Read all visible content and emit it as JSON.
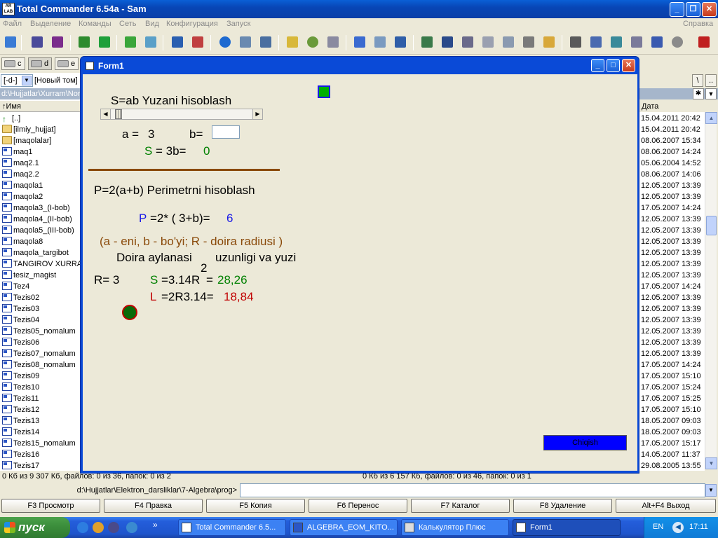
{
  "app": {
    "title": "Total Commander 6.54a - Sam",
    "menu": [
      "Файл",
      "Выделение",
      "Команды",
      "Сеть",
      "Вид",
      "Конфигурация",
      "Запуск"
    ],
    "help": "Справка"
  },
  "drives": [
    "c",
    "d",
    "e"
  ],
  "left_panel": {
    "volume_combo": "[-d-]",
    "volume_label": "[Новый том]",
    "path": "d:\\Hujjatlar\\Xurram\\Nor",
    "header_name": "↑Имя",
    "files": [
      {
        "name": "[..]",
        "kind": "up"
      },
      {
        "name": "[ilmiy_hujjat]",
        "kind": "folder"
      },
      {
        "name": "[maqolalar]",
        "kind": "folder"
      },
      {
        "name": "maq1",
        "kind": "doc"
      },
      {
        "name": "maq2.1",
        "kind": "doc"
      },
      {
        "name": "maq2.2",
        "kind": "doc"
      },
      {
        "name": "maqola1",
        "kind": "doc"
      },
      {
        "name": "maqola2",
        "kind": "doc"
      },
      {
        "name": "maqola3_(I-bob)",
        "kind": "doc"
      },
      {
        "name": "maqola4_(II-bob)",
        "kind": "doc"
      },
      {
        "name": "maqola5_(III-bob)",
        "kind": "doc"
      },
      {
        "name": "maqola8",
        "kind": "doc"
      },
      {
        "name": "maqola_targibot",
        "kind": "doc"
      },
      {
        "name": "TANGIROV XURRAM",
        "kind": "doc"
      },
      {
        "name": "tesiz_magist",
        "kind": "doc"
      },
      {
        "name": "Tez4",
        "kind": "doc"
      },
      {
        "name": "Tezis02",
        "kind": "doc"
      },
      {
        "name": "Tezis03",
        "kind": "doc"
      },
      {
        "name": "Tezis04",
        "kind": "doc"
      },
      {
        "name": "Tezis05_nomalum",
        "kind": "doc"
      },
      {
        "name": "Tezis06",
        "kind": "doc"
      },
      {
        "name": "Tezis07_nomalum",
        "kind": "doc"
      },
      {
        "name": "Tezis08_nomalum",
        "kind": "doc"
      },
      {
        "name": "Tezis09",
        "kind": "doc"
      },
      {
        "name": "Tezis10",
        "kind": "doc"
      },
      {
        "name": "Tezis11",
        "kind": "doc"
      },
      {
        "name": "Tezis12",
        "kind": "doc"
      },
      {
        "name": "Tezis13",
        "kind": "doc"
      },
      {
        "name": "Tezis14",
        "kind": "doc"
      },
      {
        "name": "Tezis15_nomalum",
        "kind": "doc"
      },
      {
        "name": "Tezis16",
        "kind": "doc"
      },
      {
        "name": "Tezis17",
        "kind": "doc"
      }
    ],
    "status": "0 Кб из 9 307 Кб, файлов: 0 из 36, папок: 0 из 2"
  },
  "right_panel": {
    "tools": [
      "\\",
      ".."
    ],
    "header_date": "Дата",
    "dates": [
      "15.04.2011 20:42",
      "15.04.2011 20:42",
      "08.06.2007 15:34",
      "08.06.2007 14:24",
      "05.06.2004 14:52",
      "08.06.2007 14:06",
      "12.05.2007 13:39",
      "12.05.2007 13:39",
      "17.05.2007 14:24",
      "12.05.2007 13:39",
      "12.05.2007 13:39",
      "12.05.2007 13:39",
      "12.05.2007 13:39",
      "12.05.2007 13:39",
      "12.05.2007 13:39",
      "17.05.2007 14:24",
      "12.05.2007 13:39",
      "12.05.2007 13:39",
      "12.05.2007 13:39",
      "12.05.2007 13:39",
      "12.05.2007 13:39",
      "12.05.2007 13:39",
      "17.05.2007 14:24",
      "17.05.2007 15:10",
      "17.05.2007 15:24",
      "17.05.2007 15:25",
      "17.05.2007 15:10",
      "18.05.2007 09:03",
      "18.05.2007 09:03",
      "17.05.2007 15:17",
      "14.05.2007 11:37",
      "29.08.2005 13:55"
    ],
    "status": "0 Кб из 6 157 Кб, файлов: 0 из 46, папок: 0 из 1"
  },
  "command_line": {
    "label": "d:\\Hujjatlar\\Elektron_darsliklar\\7-Algebra\\prog>",
    "value": ""
  },
  "fkeys": [
    "F3 Просмотр",
    "F4 Правка",
    "F5 Копия",
    "F6 Перенос",
    "F7 Каталог",
    "F8 Удаление",
    "Alt+F4 Выход"
  ],
  "form1": {
    "title": "Form1",
    "area_heading": "S=ab   Yuzani hisoblash",
    "a_label": "a =",
    "a_value": "3",
    "b_label": "b=",
    "b_input": "",
    "s_label": "S",
    "s_formula": "= 3b=",
    "s_result": "0",
    "perimeter_heading": "P=2(a+b)     Perimetrni hisoblash",
    "p_label": "P",
    "p_formula": "=2* ( 3+b)=",
    "p_result": "6",
    "legend": "(a - eni, b - bo'yi; R - doira radiusi )",
    "circle_heading": "Doira aylanasi",
    "circle_heading2": "uzunligi va  yuzi",
    "superscript": "2",
    "r_label": "R= 3",
    "cs_label": "S",
    "cs_formula": "=3.14R",
    "cs_eq": "=",
    "cs_result": "28,26",
    "cl_label": "L",
    "cl_formula": "=2R3.14=",
    "cl_result": "18,84",
    "exit_button": "Chiqish",
    "colors": {
      "green": "#008000",
      "blue": "#1a1ae6",
      "brown": "#8a4a0a",
      "red": "#c00000",
      "exit_bg": "#0000ff"
    }
  },
  "taskbar": {
    "start": "пуск",
    "tasks": [
      "Total Commander 6.5...",
      "ALGEBRA_EOM_KITO...",
      "Калькулятор Плюс",
      "Form1"
    ],
    "lang": "EN",
    "clock": "17:11"
  }
}
